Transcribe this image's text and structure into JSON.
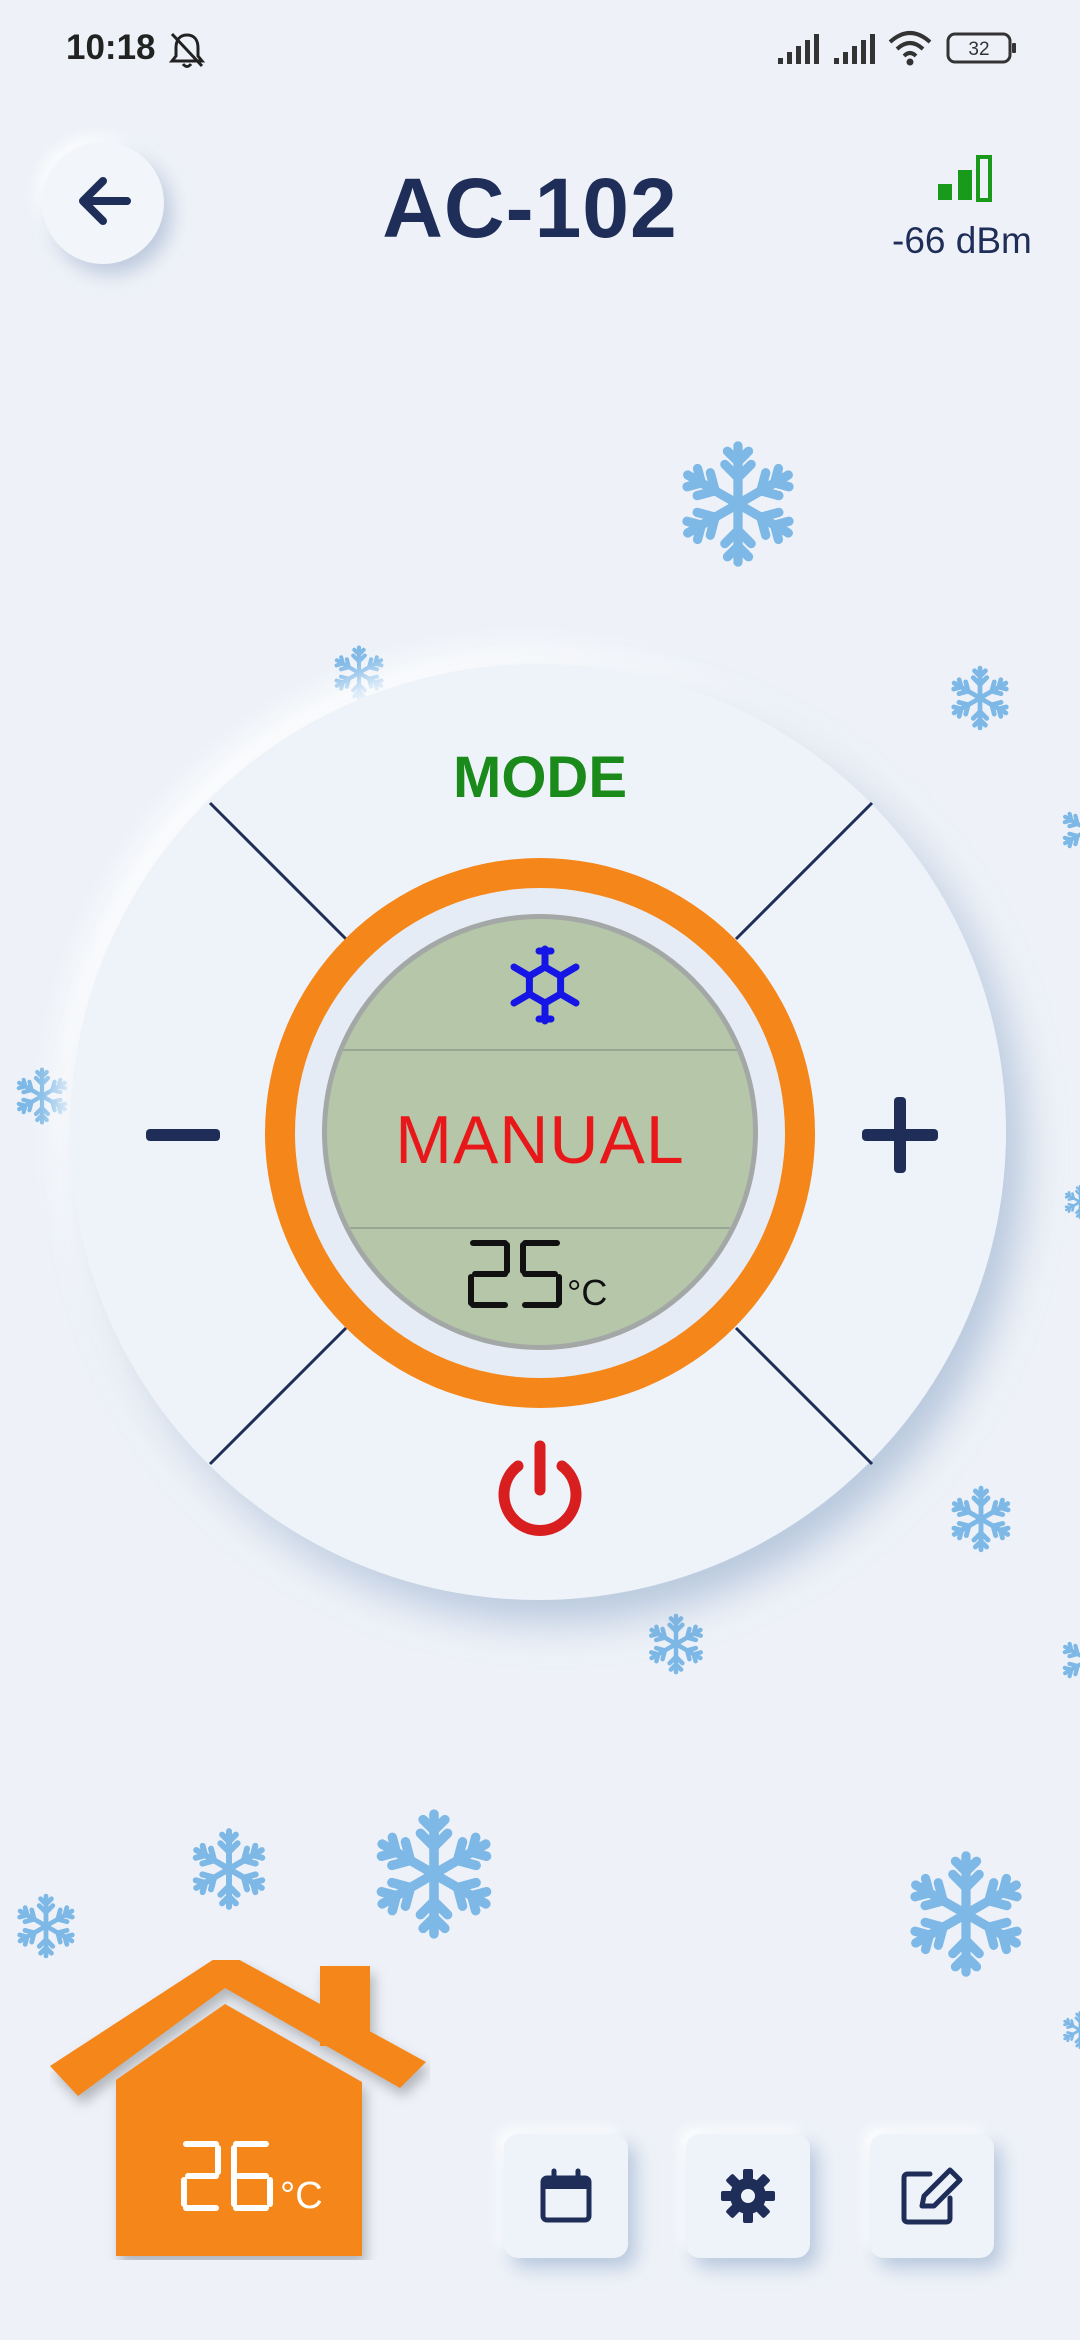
{
  "status_bar": {
    "time": "10:18",
    "battery": "32",
    "icons": [
      "bell-muted-icon",
      "cell-signal-icon",
      "cell-signal-icon",
      "wifi-icon",
      "battery-icon"
    ]
  },
  "header": {
    "back_icon": "arrow-left-icon",
    "title": "AC-102",
    "signal_strength": "-66 dBm",
    "signal_icon": "signal-bars-icon"
  },
  "dial": {
    "mode_label": "MODE",
    "minus_label": "−",
    "plus_label": "+",
    "power_icon": "power-icon",
    "lcd": {
      "mode_icon": "snowflake-icon",
      "mode_text": "MANUAL",
      "set_temperature": "25",
      "unit": "°C"
    }
  },
  "room": {
    "temperature": "26",
    "unit": "°C"
  },
  "bottom_bar": {
    "buttons": [
      "calendar-icon",
      "gear-icon",
      "edit-icon"
    ]
  },
  "colors": {
    "background": "#eef2f8",
    "title": "#1f2e58",
    "accent_orange": "#f5861a",
    "mode_green": "#1a8a1a",
    "lcd_background": "#b6c6a9",
    "lcd_text": "#e8181a",
    "snowflake": "#7db8e6",
    "power": "#d81e1e",
    "signal": "#1a9a1a"
  }
}
